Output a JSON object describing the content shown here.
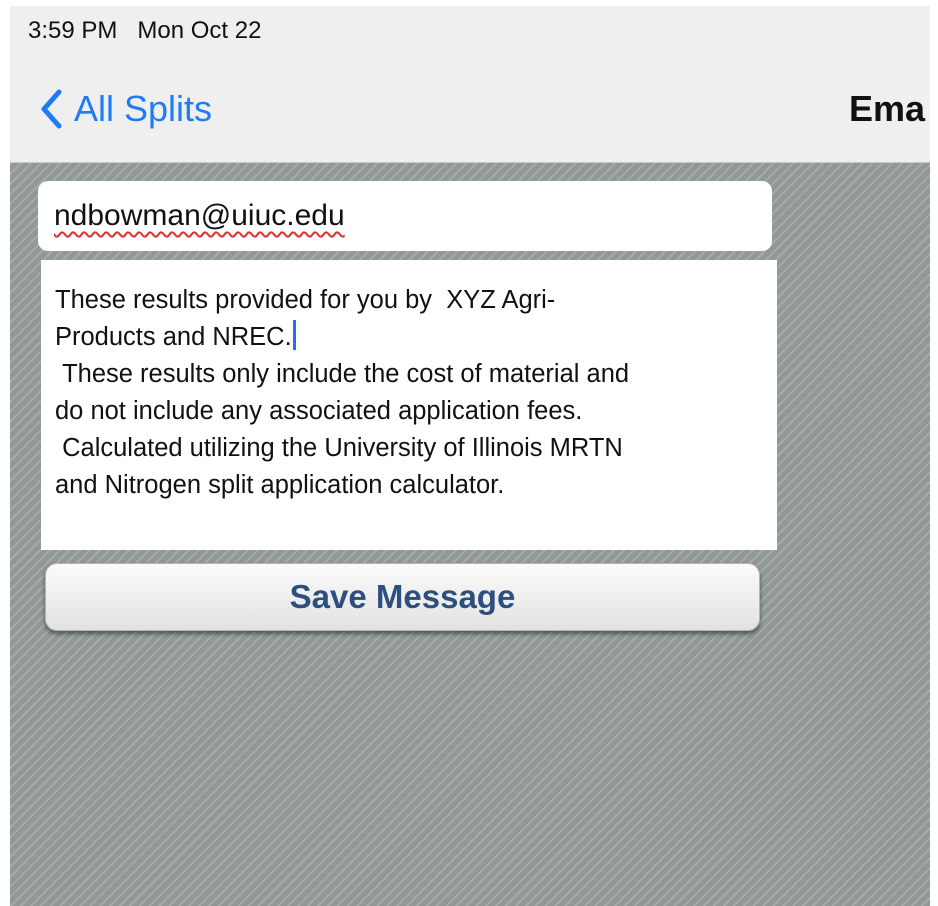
{
  "status_bar": {
    "time_date": "3:59 PM   Mon Oct 22"
  },
  "nav": {
    "back_label": "All Splits",
    "back_icon": "chevron-left-icon",
    "title": "Ema"
  },
  "form": {
    "email_value": "ndbowman@uiuc.edu",
    "message_text": "These results provided for you by  XYZ Agri-\nProducts and NREC.\n These results only include the cost of material and\ndo not include any associated application fees.\n Calculated utilizing the University of Illinois MRTN\nand Nitrogen split application calculator.",
    "save_label": "Save Message"
  },
  "colors": {
    "accent": "#1f7cf3",
    "button_text": "#2d4f7e",
    "background": "#9aa19e",
    "spellcheck": "#e03030"
  }
}
